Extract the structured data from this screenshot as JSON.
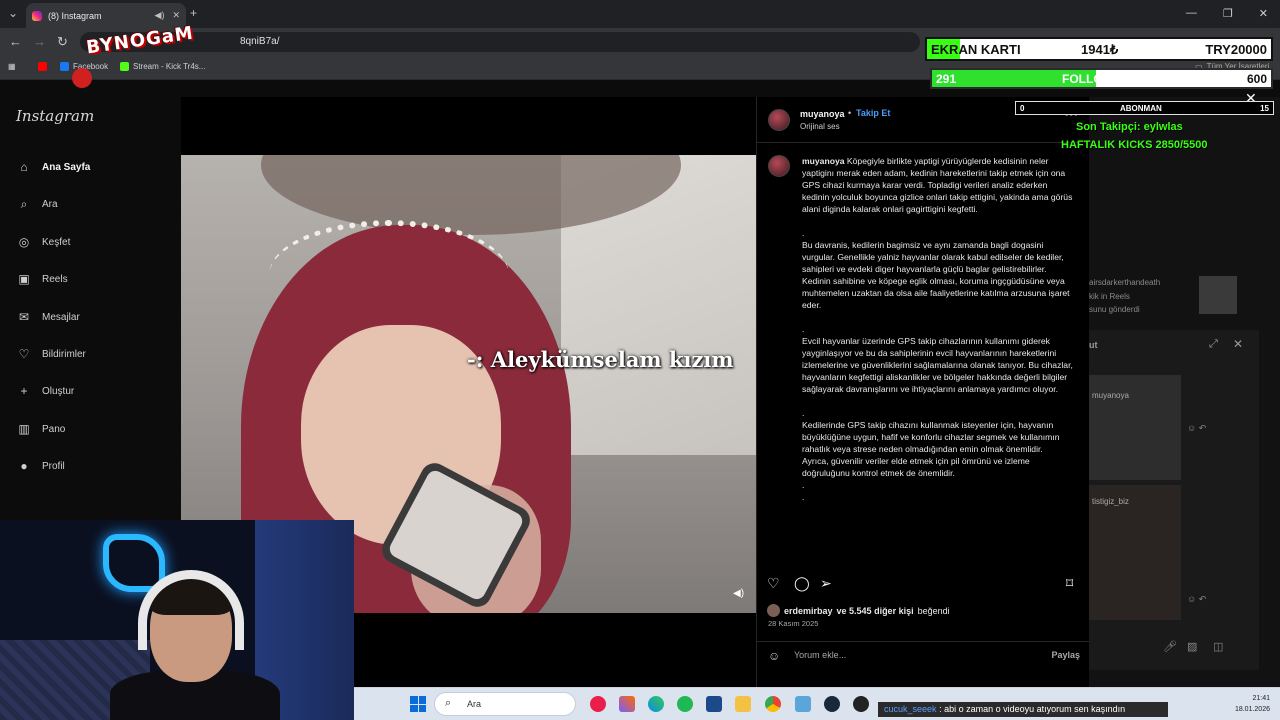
{
  "browser": {
    "tab_title": "(8) Instagram",
    "url_partial": "8qniB7a/",
    "bookmarks": [
      {
        "label": "Facebook",
        "color": "#1877f2"
      },
      {
        "label": "Stream - Kick Tr4s...",
        "color": "#53fc18"
      }
    ],
    "all_bookmarks": "Tüm Yer İşaretleri"
  },
  "brand_overlay": {
    "text": "BYNOGaM"
  },
  "stream_overlay": {
    "goal_label": "EKRAN KARTI",
    "goal_current": "1941₺",
    "goal_target": "TRY20000",
    "goal_fraction": 0.097,
    "followers_current": "291",
    "followers_label": "FOLLOWERS",
    "followers_target": "600",
    "followers_fraction": 0.485,
    "sub_current": "0",
    "sub_label": "ABONMAN",
    "sub_target": "15",
    "last_follower": "Son Takipçi: eylwlas",
    "weekly_kicks": "HAFTALIK KICKS 2850/5500"
  },
  "sidebar": {
    "logo": "Instagram",
    "items": [
      {
        "label": "Ana Sayfa",
        "icon": "home-icon",
        "glyph": "⌂"
      },
      {
        "label": "Ara",
        "icon": "search-icon",
        "glyph": "⌕"
      },
      {
        "label": "Keşfet",
        "icon": "compass-icon",
        "glyph": "◎"
      },
      {
        "label": "Reels",
        "icon": "reels-icon",
        "glyph": "▣"
      },
      {
        "label": "Mesajlar",
        "icon": "messenger-icon",
        "glyph": "✉"
      },
      {
        "label": "Bildirimler",
        "icon": "heart-icon",
        "glyph": "♡"
      },
      {
        "label": "Oluştur",
        "icon": "plus-icon",
        "glyph": "+"
      },
      {
        "label": "Pano",
        "icon": "dashboard-icon",
        "glyph": "▥"
      },
      {
        "label": "Profil",
        "icon": "profile-icon",
        "glyph": "●"
      }
    ]
  },
  "video": {
    "subtitle": "-: Aleykümselam kızım"
  },
  "post": {
    "username": "muyanoya",
    "follow": "Takip Et",
    "audio": "Orijinal ses",
    "caption": {
      "p1": "Köpegiyle birlikte yaptigi yürüyüglerde kedisinin neler yaptiginı merak eden adam, kedinin hareketlerini takip etmek için ona GPS cihazi kurmaya karar verdi. Topladigi verileri analiz ederken kedinin yolculuk boyunca gizlice onlari takip ettigini, yakinda ama görüs alani diginda kalarak onlari gagirttigini kegfetti.",
      "d1": ".",
      "p2": "Bu davranis, kedilerin bagimsiz ve aynı zamanda bagli dogasini vurgular. Genellikle yalniz hayvanlar olarak kabul edilseler de kediler, sahipleri ve evdeki diger hayvanlarla güçlü baglar gelistirebilirler.",
      "p3": "Kedinin sahibine ve köpege eglik olması, koruma ingçgüdüsüne veya muhtemelen uzaktan da olsa aile faaliyetlerine katılma arzusuna işaret eder.",
      "d2": ".",
      "p4": "Evcil hayvanlar üzerinde GPS takip cihazlarının kullanımı giderek yayginlaşıyor ve bu da sahiplerinin evcil hayvanlarının hareketlerini izlemelerine ve güvenliklerini sağlamalarına olanak tanıyor. Bu cihazlar, hayvanların kegfettigi aliskanlikler ve bölgeler hakkında değerli bilgiler sağlayarak davranışlarını ve ihtiyaçlarını anlamaya yardımcı oluyor.",
      "d3": ".",
      "p5": "Kedilerinde GPS takip cihazını kullanmak isteyenler için, hayvanın büyüklüğüne uygun, hafif ve konforlu cihazlar segmek ve kullanımın rahatlık veya strese neden olmadığından emin olmak önemlidir.",
      "p6": "Ayrıca, güvenilir veriler elde etmek için pil ömrünü ve izleme doğruluğunu kontrol etmek de önemlidir.",
      "d4": ".",
      "d5": "."
    },
    "likes_user": "erdemirbay",
    "likes_rest": "ve 5.545 diğer kişi",
    "likes_suffix": "beğendi",
    "date": "28 Kasım 2025",
    "comment_placeholder": "Yorum ekle...",
    "share": "Paylaş"
  },
  "right_panel": {
    "row1_name": "airsdarkerthandeath",
    "row1_sub1": "kik in Reels",
    "row1_sub2": "sunu gönderdi",
    "chat_header": "ut",
    "chat_user1": "muyanoya",
    "chat_user2": "tistigiz_biz"
  },
  "taskbar": {
    "search_placeholder": "Ara",
    "chat_user": "cucuk_seeek",
    "chat_message": ": abi o zaman o videoyu atıyorum sen kaşındın",
    "time": "21:41",
    "date": "18.01.2026"
  }
}
